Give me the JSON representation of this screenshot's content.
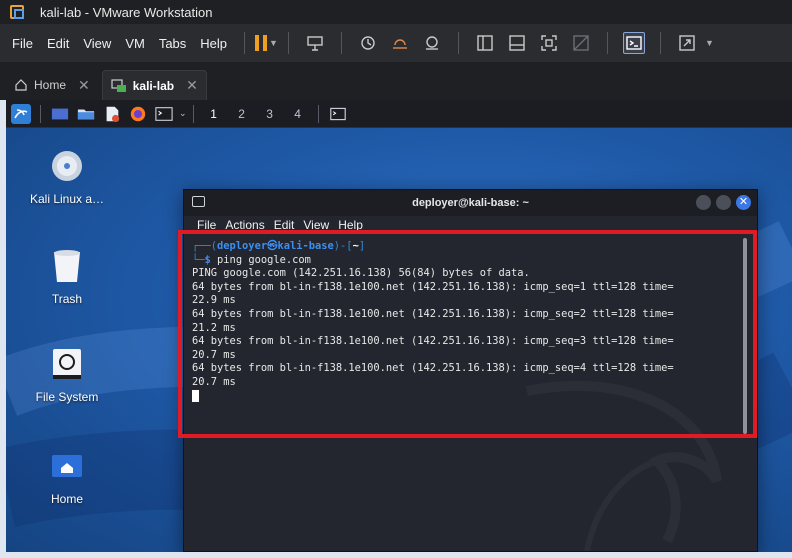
{
  "window": {
    "title": "kali-lab - VMware Workstation"
  },
  "menubar": {
    "items": [
      "File",
      "Edit",
      "View",
      "VM",
      "Tabs",
      "Help"
    ]
  },
  "tabs": [
    {
      "label": "Home",
      "icon": "home-icon",
      "active": false
    },
    {
      "label": "kali-lab",
      "icon": "vm-icon",
      "active": true
    }
  ],
  "guest_panel": {
    "workspaces": [
      "1",
      "2",
      "3",
      "4"
    ],
    "active_workspace": "1"
  },
  "desktop_icons": [
    {
      "label": "Kali Linux a…",
      "icon": "cd-icon"
    },
    {
      "label": "Trash",
      "icon": "trash-icon"
    },
    {
      "label": "File System",
      "icon": "drive-icon"
    },
    {
      "label": "Home",
      "icon": "home-folder-icon"
    }
  ],
  "terminal": {
    "title": "deployer@kali-base: ~",
    "menu": [
      "File",
      "Actions",
      "Edit",
      "View",
      "Help"
    ],
    "prompt_user": "deployer",
    "prompt_symbol": "㉿",
    "prompt_host": "kali-base",
    "prompt_dir": "~",
    "command": "ping google.com",
    "output": [
      "PING google.com (142.251.16.138) 56(84) bytes of data.",
      "64 bytes from bl-in-f138.1e100.net (142.251.16.138): icmp_seq=1 ttl=128 time=",
      "22.9 ms",
      "64 bytes from bl-in-f138.1e100.net (142.251.16.138): icmp_seq=2 ttl=128 time=",
      "21.2 ms",
      "64 bytes from bl-in-f138.1e100.net (142.251.16.138): icmp_seq=3 ttl=128 time=",
      "20.7 ms",
      "64 bytes from bl-in-f138.1e100.net (142.251.16.138): icmp_seq=4 ttl=128 time=",
      "20.7 ms"
    ]
  },
  "colors": {
    "highlight": "#e01b24",
    "pause": "#f0a020",
    "prompt": "#3c8ff0",
    "desktop": "#1f5aa8"
  }
}
